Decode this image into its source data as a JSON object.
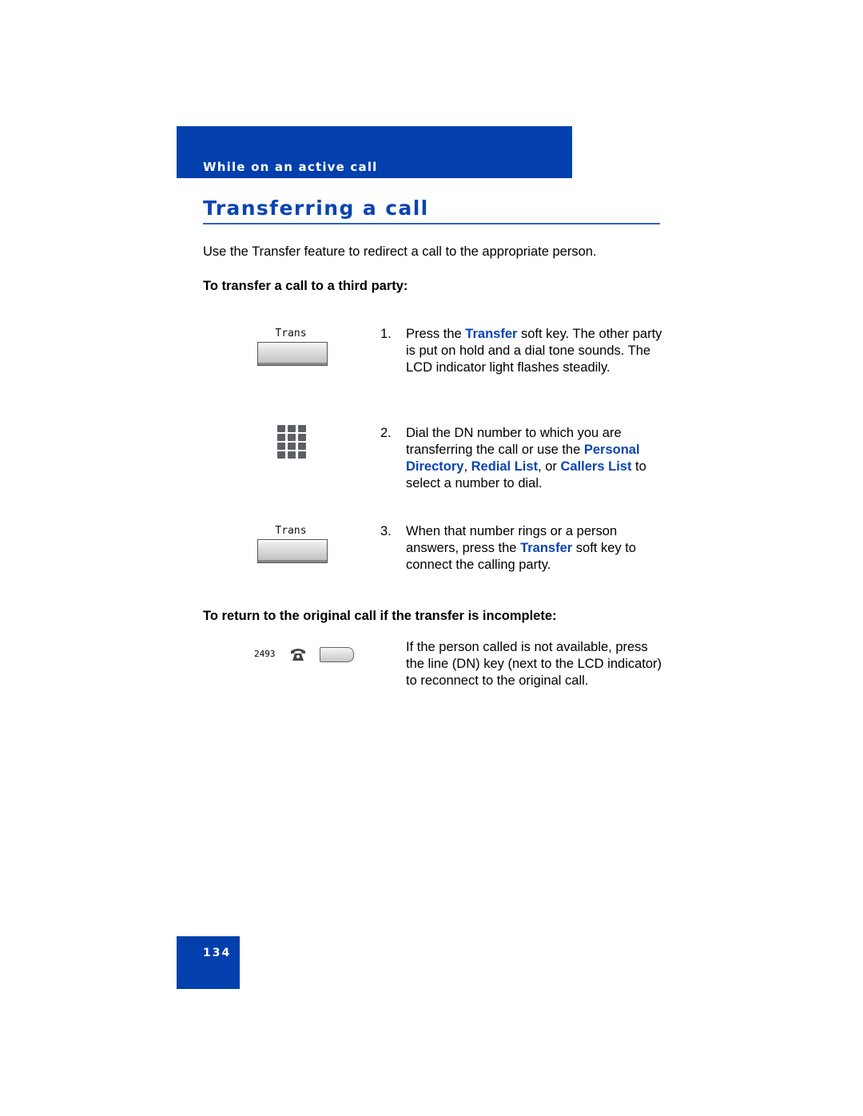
{
  "header": {
    "section_title": "While on an active call"
  },
  "page": {
    "title": "Transferring a call",
    "intro": "Use the Transfer feature to redirect a call to the appropriate person.",
    "page_number": "134"
  },
  "procedure1": {
    "heading": "To transfer a call to a third party:",
    "steps": [
      {
        "num": "1.",
        "icon": {
          "type": "soft-key",
          "label": "Trans"
        },
        "parts": [
          "Press the ",
          "Transfer",
          " soft key. The other party is put on hold and a dial tone sounds. The LCD indicator light flashes steadily."
        ]
      },
      {
        "num": "2.",
        "icon": {
          "type": "dialpad-icon"
        },
        "parts": [
          "Dial the DN number to which you are transferring the call or use the ",
          "Personal Directory",
          ", ",
          "Redial List",
          ", or ",
          "Callers List",
          " to select a number to dial."
        ]
      },
      {
        "num": "3.",
        "icon": {
          "type": "soft-key",
          "label": "Trans"
        },
        "parts": [
          "When that number rings or a person answers, press the ",
          "Transfer",
          " soft key to connect the calling party."
        ]
      }
    ]
  },
  "procedure2": {
    "heading": "To return to the original call if the transfer is incomplete:",
    "line_dn": "2493",
    "text": "If the person called is not available, press the line (DN) key (next to the LCD indicator) to reconnect to the original call."
  },
  "colors": {
    "brand_blue": "#0340ad",
    "keyword_blue": "#0a44b3"
  }
}
